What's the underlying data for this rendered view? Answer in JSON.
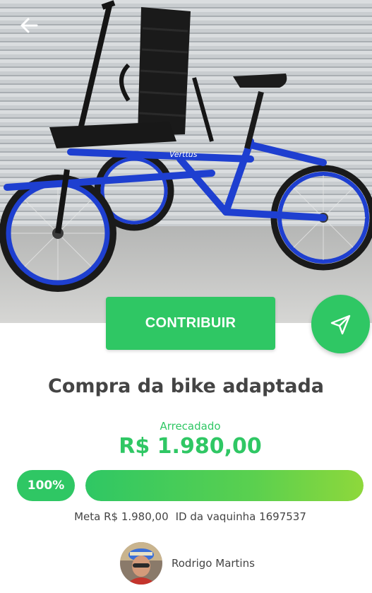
{
  "hero": {
    "image_alt": "photo of blue adapted tricycle with black seat",
    "back_icon": "arrow-left-icon"
  },
  "actions": {
    "contribute_label": "CONTRIBUIR",
    "share_icon": "send-icon"
  },
  "campaign": {
    "title": "Compra da bike adaptada",
    "raised_label": "Arrecadado",
    "raised_value": "R$ 1.980,00",
    "progress_label": "100%",
    "progress": 1.0,
    "goal_text": "Meta R$ 1.980,00",
    "id_text": "ID da vaquinha 1697537"
  },
  "owner": {
    "name": "Rodrigo Martins"
  },
  "colors": {
    "accent": "#2fc764",
    "gradient_end": "#8ed83b",
    "bike_blue": "#1e3fd0",
    "text": "#444444"
  }
}
